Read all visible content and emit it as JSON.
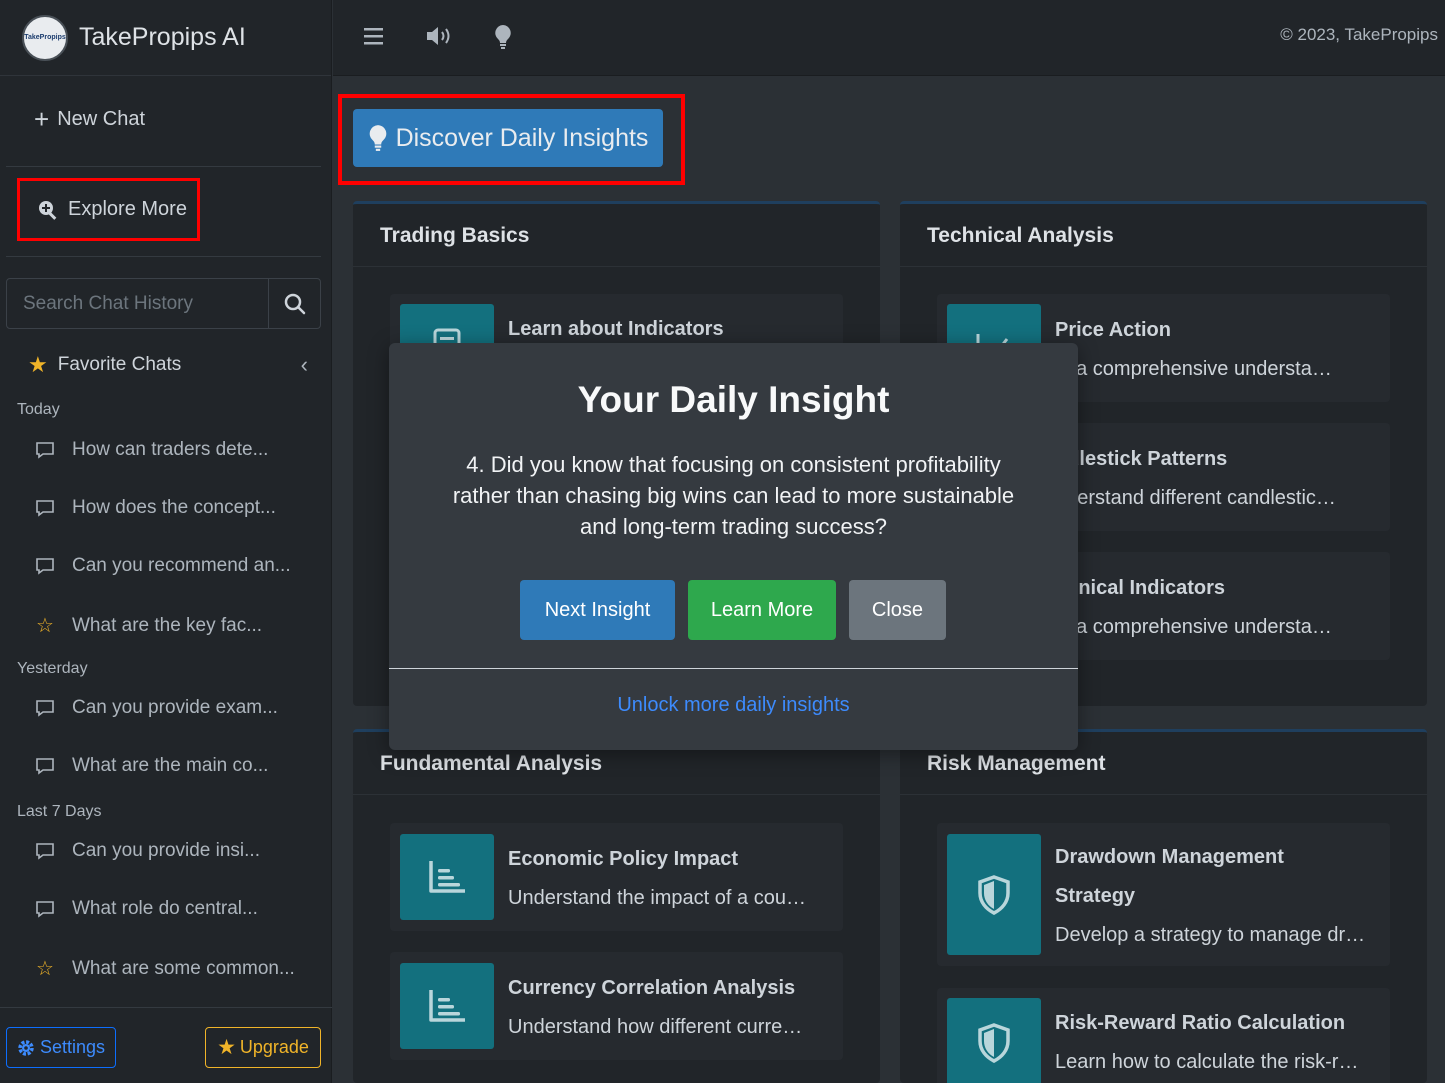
{
  "sidebar": {
    "brand_name": "TakePropips AI",
    "logo_text": "TakePropips",
    "new_chat_label": "New Chat",
    "explore_label": "Explore More",
    "search": {
      "placeholder": "Search Chat History"
    },
    "favorites_label": "Favorite Chats",
    "groups": [
      {
        "label": "Today",
        "items": [
          {
            "text": "How can traders dete...",
            "icon": "chat-bubble-icon"
          },
          {
            "text": "How does the concept...",
            "icon": "chat-bubble-icon"
          },
          {
            "text": "Can you recommend an...",
            "icon": "chat-bubble-icon"
          },
          {
            "text": "What are the key fac...",
            "icon": "star-outline-icon"
          }
        ]
      },
      {
        "label": "Yesterday",
        "items": [
          {
            "text": "Can you provide exam...",
            "icon": "chat-bubble-icon"
          },
          {
            "text": "What are the main co...",
            "icon": "chat-bubble-icon"
          }
        ]
      },
      {
        "label": "Last 7 Days",
        "items": [
          {
            "text": "Can you provide insi...",
            "icon": "chat-bubble-icon"
          },
          {
            "text": "What role do central...",
            "icon": "chat-bubble-icon"
          },
          {
            "text": "What are some common...",
            "icon": "star-outline-icon"
          }
        ]
      }
    ],
    "settings_label": "Settings",
    "upgrade_label": "Upgrade"
  },
  "topbar": {
    "icons": [
      "menu-icon",
      "speaker-icon",
      "lightbulb-icon"
    ],
    "copyright": "© 2023, TakePropips"
  },
  "main": {
    "discover_label": "Discover Daily Insights",
    "cards": [
      {
        "title": "Trading Basics",
        "topics": [
          {
            "title": "Learn about Indicators",
            "desc": ""
          }
        ]
      },
      {
        "title": "Technical Analysis",
        "topics": [
          {
            "title": "Price Action",
            "desc": "in a comprehensive understa…"
          },
          {
            "title": "ndlestick Patterns",
            "desc": "nderstand different candlestic…"
          },
          {
            "title": "chnical Indicators",
            "desc": "in a comprehensive understa…"
          }
        ]
      },
      {
        "title": "Fundamental Analysis",
        "topics": [
          {
            "title": "Economic Policy Impact",
            "desc": "Understand the impact of a cou…"
          },
          {
            "title": "Currency Correlation Analysis",
            "desc": "Understand how different curre…"
          }
        ]
      },
      {
        "title": "Risk Management",
        "topics": [
          {
            "title": "Drawdown Management",
            "title2": "Strategy",
            "desc": "Develop a strategy to manage dr…"
          },
          {
            "title": "Risk-Reward Ratio Calculation",
            "desc": "Learn how to calculate the risk-r…"
          }
        ]
      }
    ]
  },
  "modal": {
    "title": "Your Daily Insight",
    "body": "4. Did you know that focusing on consistent profitability rather than chasing big wins can lead to more sustainable and long-term trading success?",
    "next_label": "Next Insight",
    "learn_label": "Learn More",
    "close_label": "Close",
    "link_label": "Unlock more daily insights"
  },
  "colors": {
    "accent_blue": "#2f7ab8",
    "success_green": "#2ea84d",
    "star_gold": "#f0b429",
    "tile_teal": "#13707e",
    "highlight_red": "#ff0000"
  }
}
